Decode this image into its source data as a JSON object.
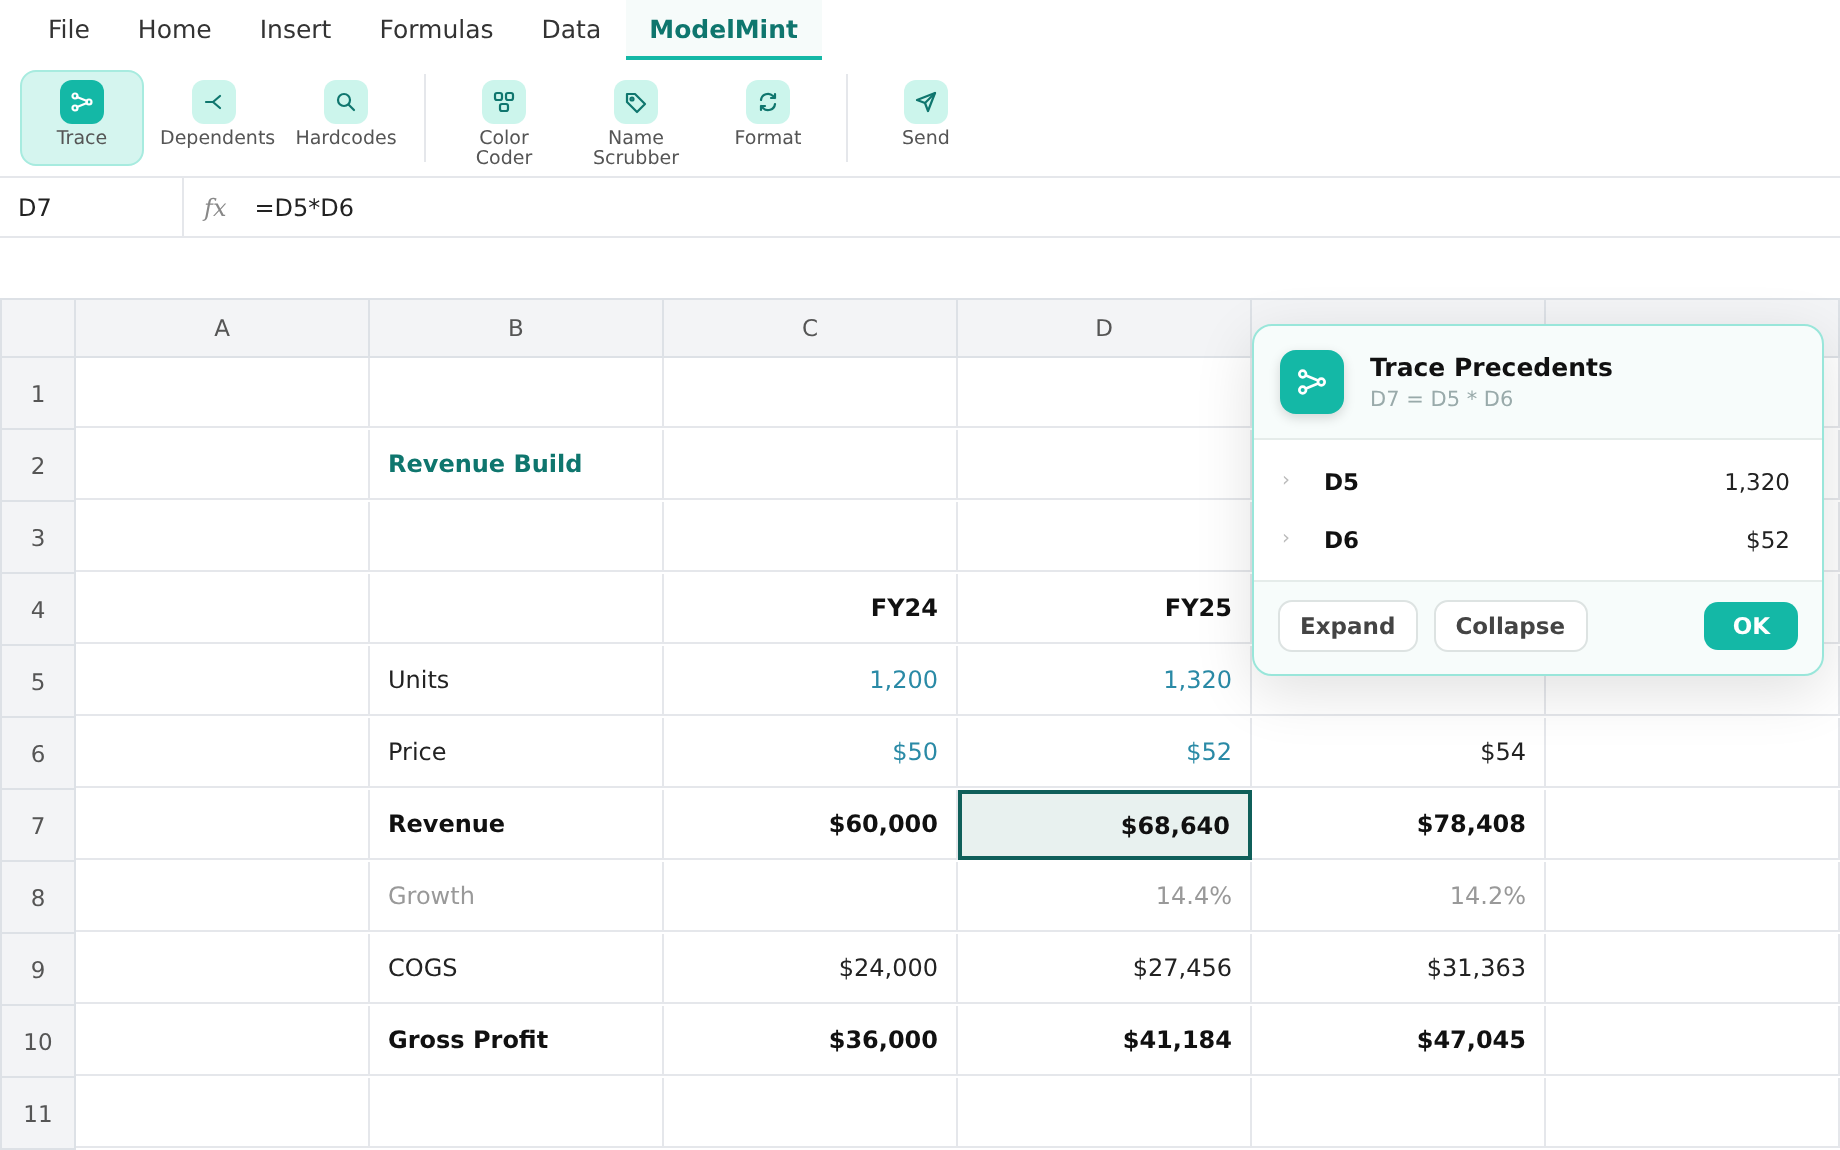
{
  "tabs": [
    {
      "label": "File",
      "selected": false
    },
    {
      "label": "Home",
      "selected": false
    },
    {
      "label": "Insert",
      "selected": false
    },
    {
      "label": "Formulas",
      "selected": false
    },
    {
      "label": "Data",
      "selected": false
    },
    {
      "label": "ModelMint",
      "selected": true
    }
  ],
  "ribbon": {
    "groups": [
      [
        {
          "label": "Trace",
          "selected": true
        },
        {
          "label": "Dependents",
          "selected": false
        },
        {
          "label": "Hardcodes",
          "selected": false
        }
      ],
      [
        {
          "label": "Color Coder",
          "selected": false
        },
        {
          "label": "Name Scrubber",
          "selected": false
        },
        {
          "label": "Format",
          "selected": false
        }
      ],
      [
        {
          "label": "Send",
          "selected": false
        }
      ]
    ]
  },
  "formula_bar": {
    "cell": "D7",
    "fx": "fx",
    "formula": "=D5*D6"
  },
  "grid": {
    "columns": [
      "A",
      "B",
      "C",
      "D"
    ],
    "rows": [
      {
        "number": "1",
        "cells": [
          null,
          null,
          null,
          null,
          null,
          null
        ]
      },
      {
        "number": "2",
        "cells": [
          null,
          {
            "text": "Revenue Build",
            "kind": "title"
          },
          null,
          null,
          null,
          null
        ]
      },
      {
        "number": "3",
        "cells": [
          null,
          null,
          null,
          null,
          null,
          null
        ]
      },
      {
        "number": "4",
        "cells": [
          null,
          null,
          {
            "text": "FY24",
            "kind": "bold"
          },
          {
            "text": "FY25",
            "kind": "bold"
          },
          null,
          null
        ]
      },
      {
        "number": "5",
        "cells": [
          null,
          {
            "text": "Units",
            "kind": "label"
          },
          {
            "text": "1,200",
            "kind": "input"
          },
          {
            "text": "1,320",
            "kind": "input"
          },
          null,
          null
        ]
      },
      {
        "number": "6",
        "cells": [
          null,
          {
            "text": "Price",
            "kind": "label"
          },
          {
            "text": "$50",
            "kind": "input"
          },
          {
            "text": "$52",
            "kind": "input"
          },
          {
            "text": "$54",
            "kind": "number"
          },
          null
        ]
      },
      {
        "number": "7",
        "cells": [
          null,
          {
            "text": "Revenue",
            "kind": "boldlabel"
          },
          {
            "text": "$60,000",
            "kind": "bold"
          },
          {
            "text": "$68,640",
            "kind": "bold",
            "selected": true
          },
          {
            "text": "$78,408",
            "kind": "bold"
          },
          null
        ]
      },
      {
        "number": "8",
        "cells": [
          null,
          {
            "text": "Growth",
            "kind": "mutedlabel"
          },
          null,
          {
            "text": "14.4%",
            "kind": "muted"
          },
          {
            "text": "14.2%",
            "kind": "muted"
          },
          null
        ]
      },
      {
        "number": "9",
        "cells": [
          null,
          {
            "text": "COGS",
            "kind": "label"
          },
          {
            "text": "$24,000",
            "kind": "number"
          },
          {
            "text": "$27,456",
            "kind": "number"
          },
          {
            "text": "$31,363",
            "kind": "number"
          },
          null
        ]
      },
      {
        "number": "10",
        "cells": [
          null,
          {
            "text": "Gross Profit",
            "kind": "boldlabel"
          },
          {
            "text": "$36,000",
            "kind": "bold"
          },
          {
            "text": "$41,184",
            "kind": "bold"
          },
          {
            "text": "$47,045",
            "kind": "bold"
          },
          null
        ]
      },
      {
        "number": "11",
        "cells": [
          null,
          null,
          null,
          null,
          null,
          null
        ]
      }
    ]
  },
  "popup": {
    "title": "Trace Precedents",
    "subtitle": "D7 = D5 * D6",
    "items": [
      {
        "arrow": "›",
        "ref": "D5",
        "value": "1,320"
      },
      {
        "arrow": "›",
        "ref": "D6",
        "value": "$52"
      }
    ],
    "buttons": [
      {
        "label": "Expand",
        "kind": "secondary"
      },
      {
        "label": "Collapse",
        "kind": "secondary"
      },
      {
        "label": "OK",
        "kind": "primary"
      }
    ]
  }
}
